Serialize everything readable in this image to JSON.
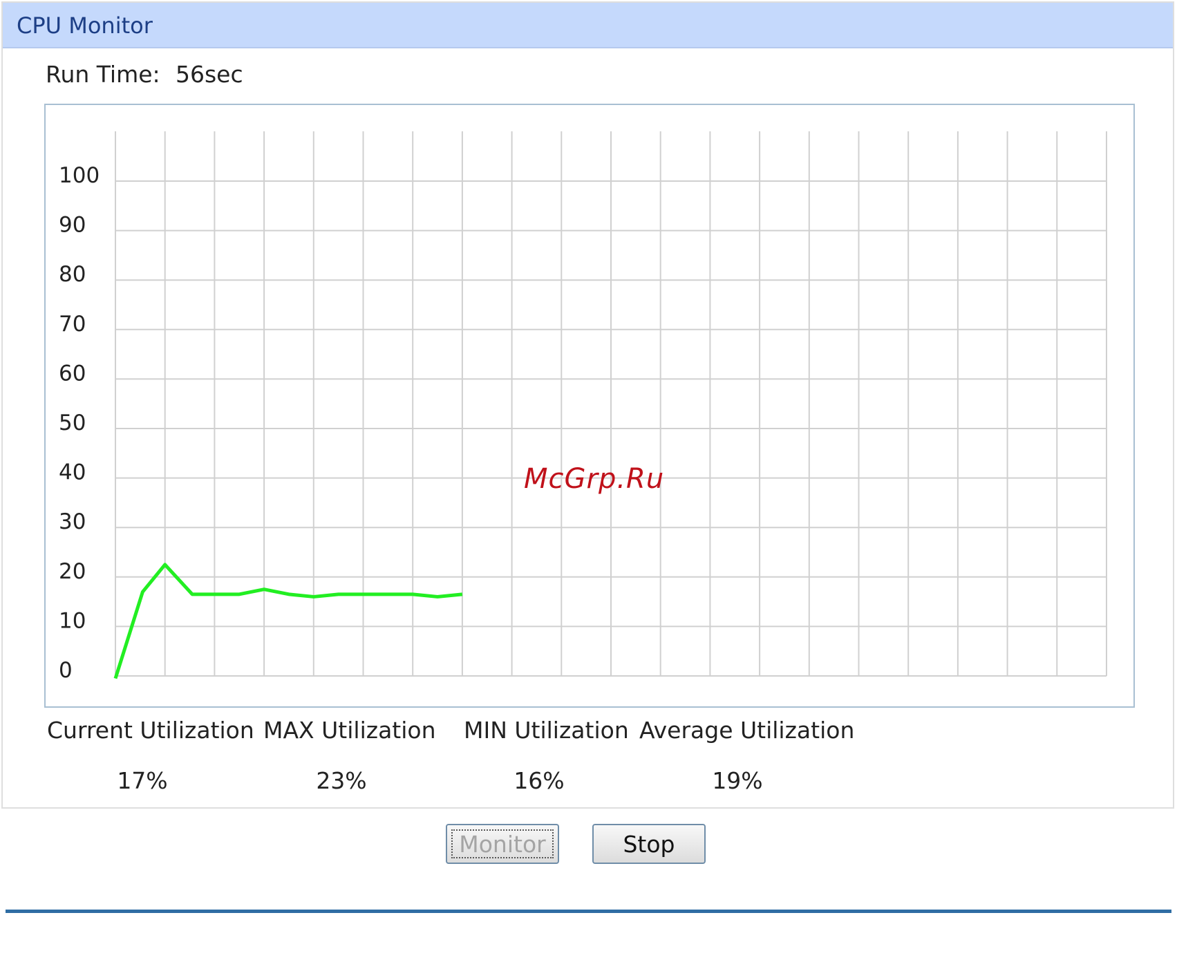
{
  "panel": {
    "title": "CPU Monitor",
    "run_time_label": "Run Time:",
    "run_time_value": "56sec"
  },
  "chart_data": {
    "type": "line",
    "title": "",
    "xlabel": "",
    "ylabel": "",
    "ylim": [
      0,
      100
    ],
    "y_ticks": [
      "100",
      "90",
      "80",
      "70",
      "60",
      "50",
      "40",
      "30",
      "20",
      "10",
      "0"
    ],
    "grid": true,
    "x_interval_count": 20,
    "line_color": "#22ee22",
    "series": [
      {
        "x": [
          0,
          0.55,
          1,
          1.55,
          2,
          2.5,
          3,
          3.5,
          4,
          4.5,
          5,
          5.5,
          6,
          6.5,
          7
        ],
        "values": [
          -0.5,
          17,
          22.5,
          16.5,
          16.5,
          16.5,
          17.5,
          16.5,
          16,
          16.5,
          16.5,
          16.5,
          16.5,
          16,
          16.5
        ]
      }
    ]
  },
  "stats": [
    {
      "label": "Current Utilization",
      "value": "17%"
    },
    {
      "label": "MAX Utilization",
      "value": "23%"
    },
    {
      "label": "MIN Utilization",
      "value": "16%"
    },
    {
      "label": "Average Utilization",
      "value": "19%"
    }
  ],
  "watermark": "McGrp.Ru",
  "buttons": {
    "monitor": "Monitor",
    "stop": "Stop"
  }
}
